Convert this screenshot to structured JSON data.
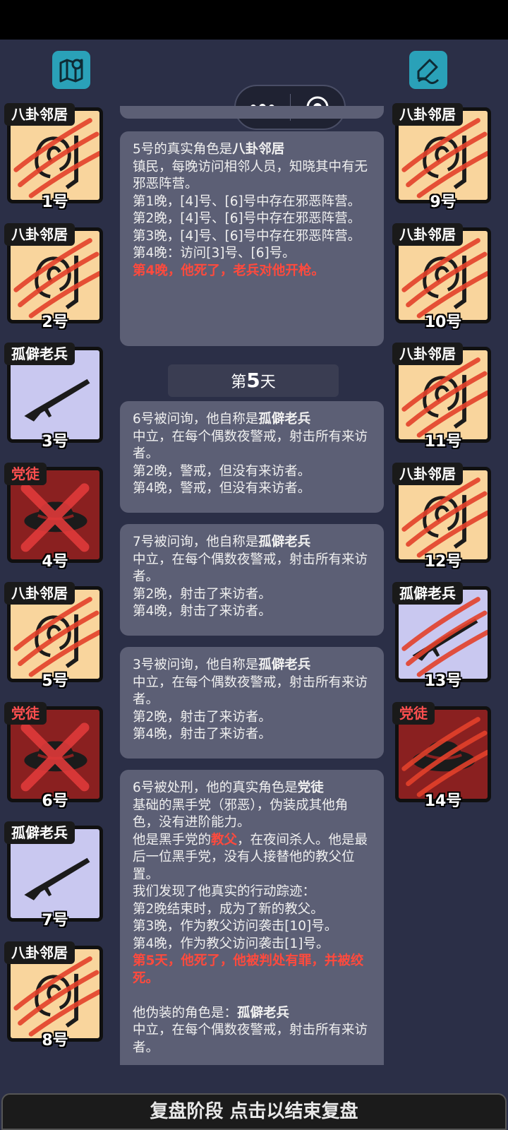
{
  "toolbar": {
    "map_icon": "map-icon",
    "note_icon": "edit-note-icon"
  },
  "miniprogram": {
    "more_icon": "more-dots-icon",
    "close_icon": "target-circle-icon"
  },
  "players": [
    {
      "num": "1号",
      "role": "八卦邻居",
      "type": "neighbor",
      "dead": true,
      "side": "left"
    },
    {
      "num": "2号",
      "role": "八卦邻居",
      "type": "neighbor",
      "dead": true,
      "side": "left"
    },
    {
      "num": "3号",
      "role": "孤僻老兵",
      "type": "veteran",
      "dead": false,
      "side": "left"
    },
    {
      "num": "4号",
      "role": "党徒",
      "type": "cultist",
      "dead": true,
      "side": "left"
    },
    {
      "num": "5号",
      "role": "八卦邻居",
      "type": "neighbor",
      "dead": true,
      "side": "left"
    },
    {
      "num": "6号",
      "role": "党徒",
      "type": "cultist",
      "dead": true,
      "side": "left"
    },
    {
      "num": "7号",
      "role": "孤僻老兵",
      "type": "veteran",
      "dead": false,
      "side": "left"
    },
    {
      "num": "8号",
      "role": "八卦邻居",
      "type": "neighbor",
      "dead": true,
      "side": "left"
    },
    {
      "num": "9号",
      "role": "八卦邻居",
      "type": "neighbor",
      "dead": true,
      "side": "right"
    },
    {
      "num": "10号",
      "role": "八卦邻居",
      "type": "neighbor",
      "dead": true,
      "side": "right"
    },
    {
      "num": "11号",
      "role": "八卦邻居",
      "type": "neighbor",
      "dead": true,
      "side": "right"
    },
    {
      "num": "12号",
      "role": "八卦邻居",
      "type": "neighbor",
      "dead": true,
      "side": "right"
    },
    {
      "num": "13号",
      "role": "孤僻老兵",
      "type": "veteran",
      "dead": true,
      "side": "right"
    },
    {
      "num": "14号",
      "role": "党徒",
      "type": "cultist",
      "dead": true,
      "side": "right"
    }
  ],
  "feed": {
    "msg1": {
      "lead": "5号的真实角色是",
      "role": "八卦邻居",
      "desc": "镇民，每晚访问相邻人员，知晓其中有无邪恶阵营。",
      "line1": "第1晚，[4]号、[6]号中存在邪恶阵营。",
      "line2": "第2晚，[4]号、[6]号中存在邪恶阵营。",
      "line3": "第3晚，[4]号、[6]号中存在邪恶阵营。",
      "line4": "第4晚：访问[3]号、[6]号。",
      "death": "第4晚，他死了，老兵对他开枪。"
    },
    "day": {
      "prefix": "第",
      "num": "5",
      "suffix": "天"
    },
    "msg2": {
      "lead": "6号被问询，他自称是",
      "role": "孤僻老兵",
      "desc": "中立，在每个偶数夜警戒，射击所有来访者。",
      "line1": "第2晚，警戒，但没有来访者。",
      "line2": "第4晚，警戒，但没有来访者。"
    },
    "msg3": {
      "lead": "7号被问询，他自称是",
      "role": "孤僻老兵",
      "desc": "中立，在每个偶数夜警戒，射击所有来访者。",
      "line1": "第2晚，射击了来访者。",
      "line2": "第4晚，射击了来访者。"
    },
    "msg4": {
      "lead": "3号被问询，他自称是",
      "role": "孤僻老兵",
      "desc": "中立，在每个偶数夜警戒，射击所有来访者。",
      "line1": "第2晚，射击了来访者。",
      "line2": "第4晚，射击了来访者。"
    },
    "msg5": {
      "lead": "6号被处刑，他的真实角色是",
      "role": "党徒",
      "desc": "基础的黑手党（邪恶），伪装成其他角色，没有进阶能力。",
      "godfather_pre": "他是黑手党的",
      "godfather": "教父",
      "godfather_post": "，在夜间杀人。他是最后一位黑手党，没有人接替他的教父位置。",
      "trace": "我们发现了他真实的行动踪迹：",
      "line1": "第2晚结束时，成为了新的教父。",
      "line2": "第3晚，作为教父访问袭击[10]号。",
      "line3": "第4晚，作为教父访问袭击[1]号。",
      "death": "第5天，他死了，他被判处有罪，并被绞死。",
      "disguise_lead": "他伪装的角色是：",
      "disguise_role": "孤僻老兵",
      "disguise_desc": "中立，在每个偶数夜警戒，射击所有来访者。"
    }
  },
  "bottom": {
    "label": "复盘阶段 点击以结束复盘"
  }
}
